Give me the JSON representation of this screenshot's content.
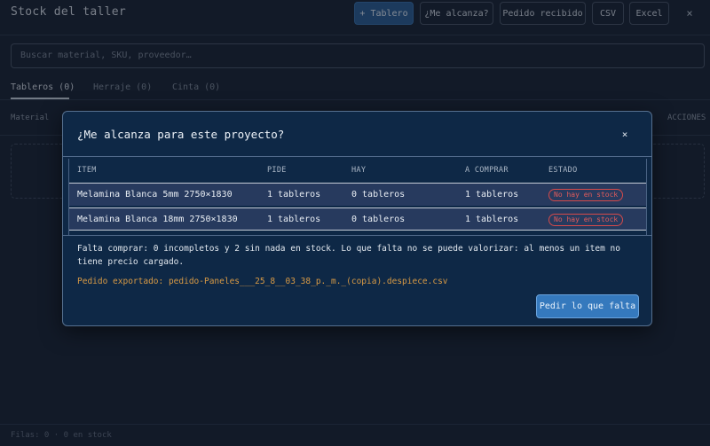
{
  "app": {
    "title": "Stock del taller",
    "toolbar": {
      "add_board_label": "+ Tablero",
      "enough_label": "¿Me alcanza?",
      "order_received_label": "Pedido recibido",
      "csv_label": "CSV",
      "excel_label": "Excel",
      "close_label": "×"
    },
    "search": {
      "placeholder": "Buscar material, SKU, proveedor…"
    },
    "tabs": [
      {
        "label": "Tableros (0)",
        "active": true
      },
      {
        "label": "Herraje (0)",
        "active": false
      },
      {
        "label": "Cinta (0)",
        "active": false
      }
    ],
    "columns": {
      "first": "Material",
      "last": "ACCIONES"
    },
    "footer": "Filas: 0 · 0 en stock"
  },
  "modal": {
    "title": "¿Me alcanza para este proyecto?",
    "close_label": "×",
    "table": {
      "headers": [
        "ITEM",
        "PIDE",
        "HAY",
        "A COMPRAR",
        "ESTADO"
      ],
      "rows": [
        {
          "item": "Melamina Blanca 5mm 2750×1830",
          "pide": "1 tableros",
          "hay": "0 tableros",
          "comprar": "1 tableros",
          "estado": "No hay en stock"
        },
        {
          "item": "Melamina Blanca 18mm 2750×1830",
          "pide": "1 tableros",
          "hay": "0 tableros",
          "comprar": "1 tableros",
          "estado": "No hay en stock"
        }
      ]
    },
    "summary": "Falta comprar: 0 incompletos y 2 sin nada en stock. Lo que falta no se puede valorizar: al menos un item no tiene precio cargado.",
    "export_note": "Pedido exportado: pedido-Paneles___25_8__03_38_p._m._(copia).despiece.csv",
    "action_label": "Pedir lo que falta"
  },
  "colors": {
    "background": "#1b2636",
    "modal_bg": "#0e2846",
    "accent": "#3579bd",
    "danger": "#e25b5b",
    "warning_text": "#d89a45"
  }
}
